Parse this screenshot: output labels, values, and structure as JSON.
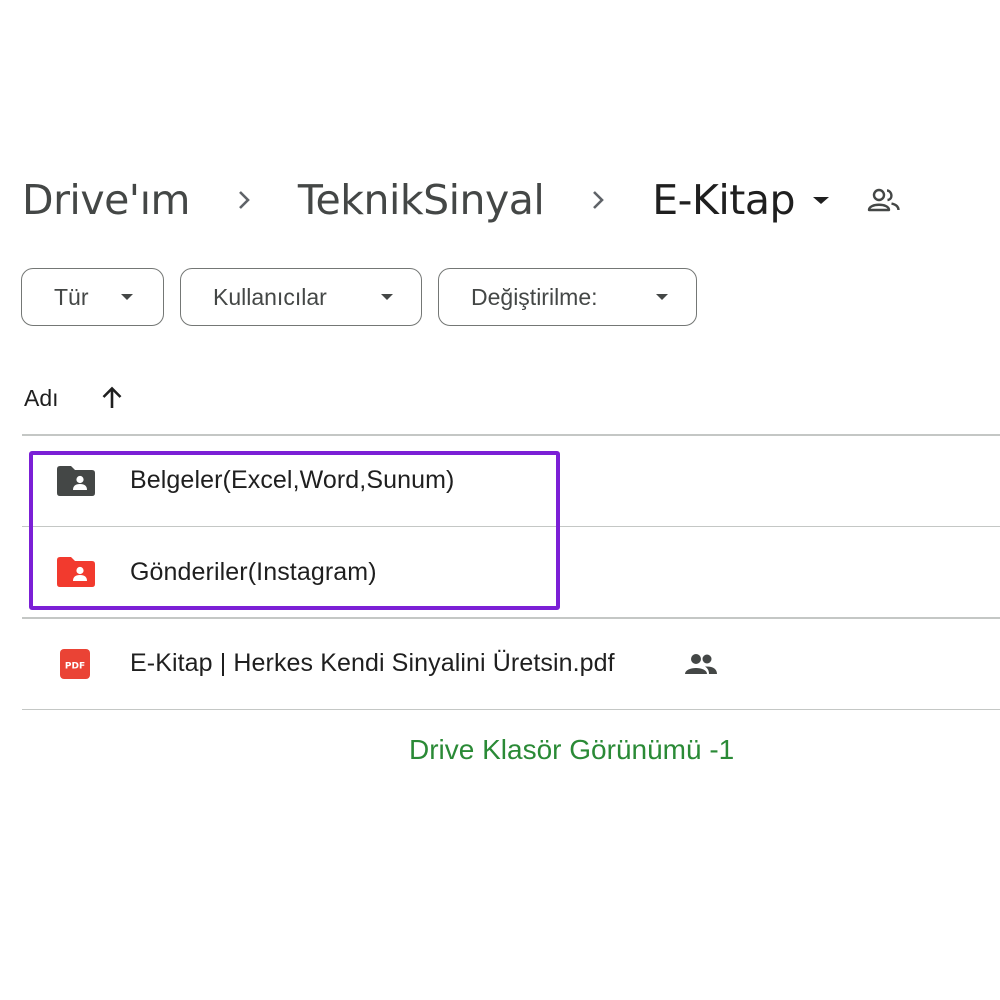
{
  "breadcrumb": {
    "items": [
      "Drive'ım",
      "TeknikSinyal"
    ],
    "current": "E-Kitap",
    "share_icon": "people-icon"
  },
  "filters": {
    "type_label": "Tür",
    "people_label": "Kullanıcılar",
    "modified_label": "Değiştirilme:"
  },
  "list_header": {
    "name_label": "Adı",
    "sort_icon": "arrow-up-icon"
  },
  "files": [
    {
      "name": "Belgeler(Excel,Word,Sunum)",
      "icon": "shared-folder-icon",
      "color": "#444746"
    },
    {
      "name": "Gönderiler(Instagram)",
      "icon": "shared-folder-icon",
      "color": "#f23a2e"
    },
    {
      "name": "E-Kitap | Herkes Kendi Sinyalini Üretsin.pdf",
      "icon": "pdf-icon",
      "color": "#ea4335",
      "shared": true,
      "icon_text": "PDF"
    }
  ],
  "highlight_color": "#7b1fd6",
  "caption": "Drive Klasör Görünümü -1"
}
